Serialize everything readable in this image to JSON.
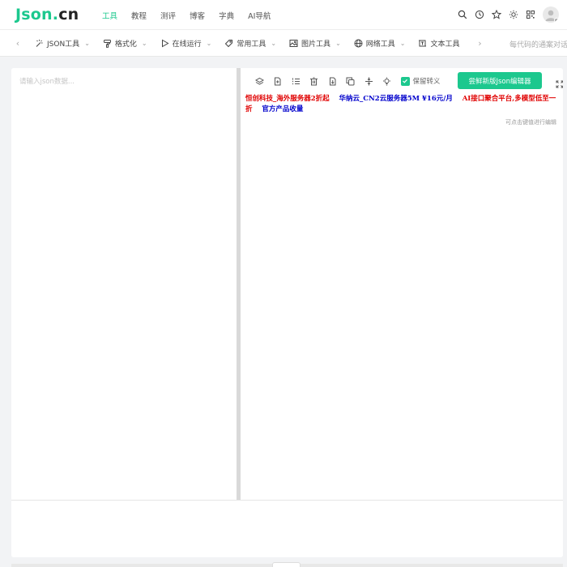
{
  "logo": {
    "part1": "Json",
    "part2": ".",
    "part3": "cn"
  },
  "nav": [
    {
      "label": "工具",
      "active": true
    },
    {
      "label": "教程",
      "active": false
    },
    {
      "label": "测评",
      "active": false
    },
    {
      "label": "博客",
      "active": false
    },
    {
      "label": "字典",
      "active": false
    },
    {
      "label": "AI导航",
      "active": false
    }
  ],
  "top_icons": [
    "search-icon",
    "history-icon",
    "star-icon",
    "sun-icon",
    "qrcode-icon"
  ],
  "subnav": {
    "items": [
      {
        "label": "JSON工具",
        "icon": "magic-icon"
      },
      {
        "label": "格式化",
        "icon": "brush-icon"
      },
      {
        "label": "在线运行",
        "icon": "play-icon"
      },
      {
        "label": "常用工具",
        "icon": "tag-icon"
      },
      {
        "label": "图片工具",
        "icon": "image-icon"
      },
      {
        "label": "网络工具",
        "icon": "globe-icon"
      },
      {
        "label": "文本工具",
        "icon": "text-icon"
      }
    ],
    "right_text": "每代码的通案对话"
  },
  "editor": {
    "placeholder": "请输入json数据...",
    "escape_label": "保留转义",
    "new_editor_button": "尝鲜新版Json编辑器",
    "hint": "可点击键值进行编辑",
    "ads": [
      {
        "text": "恒创科技_海外服务器2折起",
        "color": "red"
      },
      {
        "text": "华纳云_CN2云服务器5M ¥16元/月",
        "color": "blue"
      },
      {
        "text": "AI接口聚合平台,多模型低至一折",
        "color": "red"
      },
      {
        "text": "官方产品收量",
        "color": "blue"
      }
    ]
  },
  "colors": {
    "accent": "#1cc88e",
    "ad_red": "#e00000",
    "ad_blue": "#0000cc"
  }
}
